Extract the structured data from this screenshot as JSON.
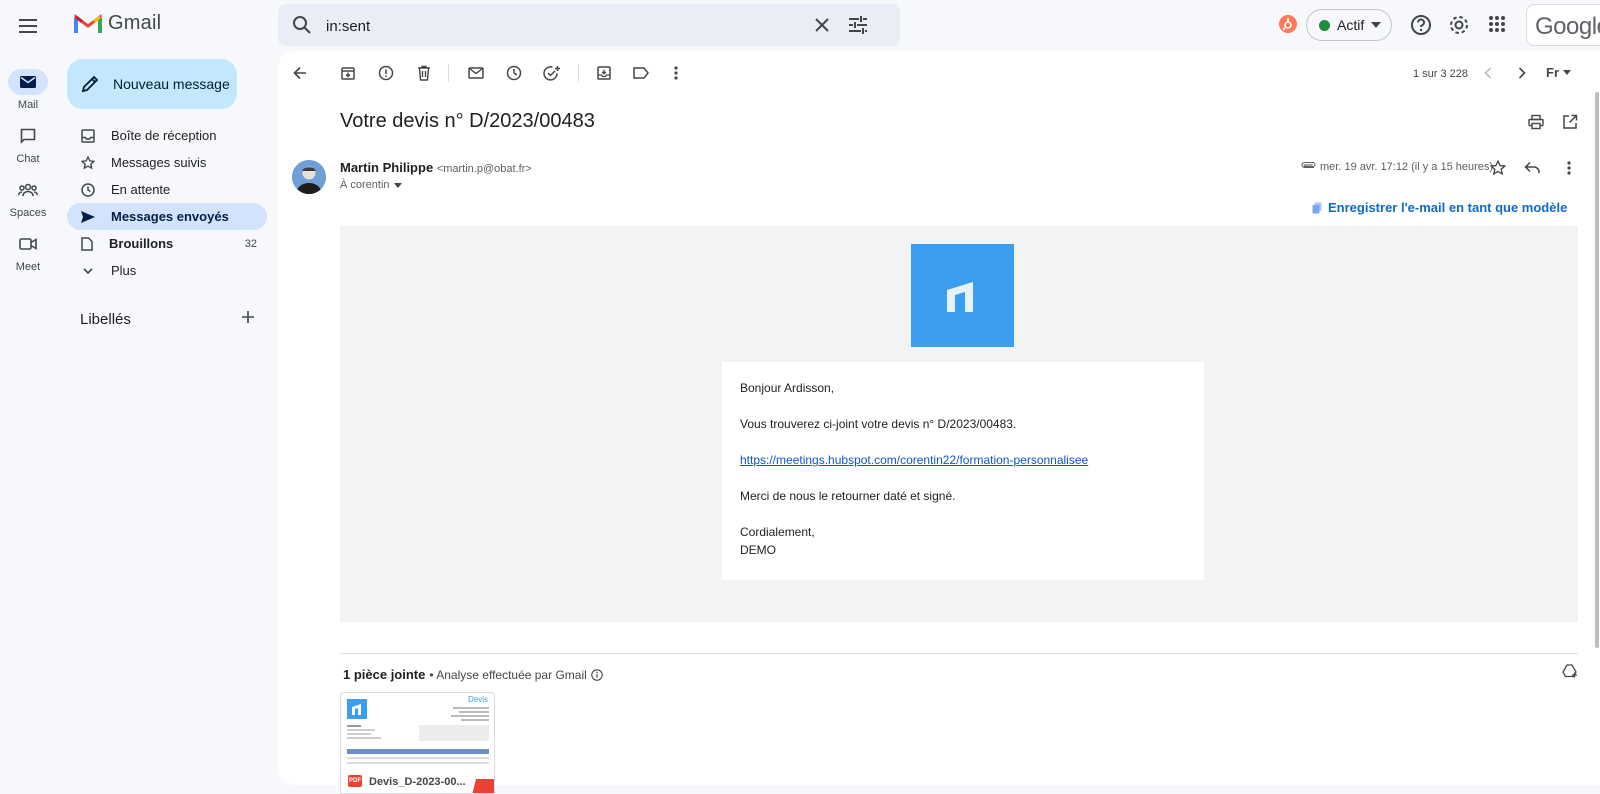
{
  "app": {
    "name": "Gmail"
  },
  "search": {
    "query": "in:sent"
  },
  "status": {
    "label": "Actif"
  },
  "brand": {
    "google": "Google"
  },
  "rail": [
    {
      "label": "Mail"
    },
    {
      "label": "Chat"
    },
    {
      "label": "Spaces"
    },
    {
      "label": "Meet"
    }
  ],
  "compose": {
    "label": "Nouveau message"
  },
  "nav": {
    "inbox": "Boîte de réception",
    "starred": "Messages suivis",
    "snoozed": "En attente",
    "sent": "Messages envoyés",
    "drafts": "Brouillons",
    "drafts_count": "32",
    "more": "Plus"
  },
  "labels": {
    "title": "Libellés"
  },
  "toolbar": {
    "counter": "1 sur 3 228",
    "lang": "Fr"
  },
  "email": {
    "subject": "Votre devis n° D/2023/00483",
    "sender_name": "Martin Philippe",
    "sender_email": "<martin.p@obat.fr>",
    "to": "À corentin",
    "date": "mer. 19 avr. 17:12 (il y a 15 heures)",
    "template_link": "Enregistrer l'e-mail en tant que modèle",
    "body": {
      "greeting": "Bonjour Ardisson,",
      "line1": "Vous trouverez ci-joint votre devis n° D/2023/00483.",
      "link": "https://meetings.hubspot.com/corentin22/formation-personnalisee",
      "line2": "Merci de nous le retourner daté et signé.",
      "closing": "Cordialement,",
      "signature": "DEMO"
    }
  },
  "attachments": {
    "title": "1 pièce jointe",
    "scan_note": " • Analyse effectuée par Gmail",
    "file_name": "Devis_D-2023-00...",
    "preview_heading": "Devis",
    "file_type": "PDF"
  },
  "colors": {
    "accent": "#0b57d0",
    "compose_bg": "#c2e7ff",
    "active_nav": "#d3e3fd",
    "brand_blue": "#3c9ef0",
    "status_green": "#1e8e3e"
  }
}
